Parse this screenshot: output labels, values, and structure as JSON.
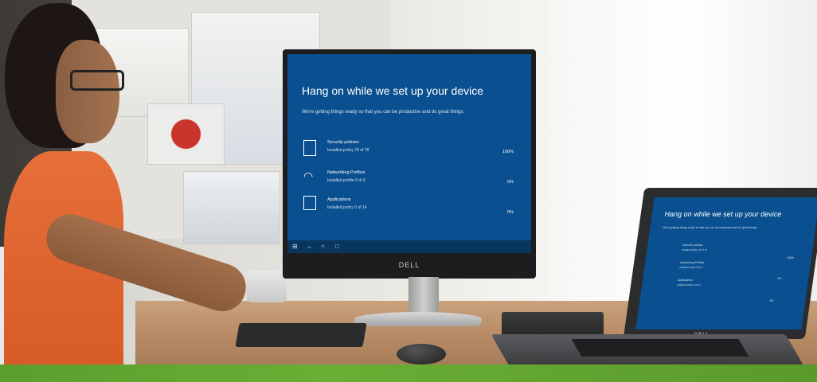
{
  "monitor": {
    "brand": "DELL",
    "screen": {
      "title": "Hang on while we set up your device",
      "subtitle": "We're getting things ready so that you can be productive and do great things.",
      "items": [
        {
          "icon": "document-icon",
          "title": "Security policies",
          "status": "Installed policy 78 of 78",
          "percent": "100%"
        },
        {
          "icon": "wifi-icon",
          "title": "Networking Profiles",
          "status": "Installed profile 0 of 3",
          "percent": "0%"
        },
        {
          "icon": "tablet-icon",
          "title": "Applications",
          "status": "Installed policy 0 of 14",
          "percent": "0%"
        }
      ]
    }
  },
  "laptop": {
    "brand": "DELL",
    "screen": {
      "title": "Hang on while we set up your device",
      "subtitle": "We're getting things ready so that you can be productive and do great things.",
      "items": [
        {
          "title": "Security policies",
          "status": "Installed policy 78 of 78",
          "percent": "100%"
        },
        {
          "title": "Networking Profiles",
          "status": "Installed profile 0 of 3",
          "percent": "0%"
        },
        {
          "title": "Applications",
          "status": "Installed policy 0 of 14",
          "percent": "0%"
        }
      ]
    }
  },
  "colors": {
    "screen_blue": "#0a4f8f",
    "desk_green_strip": "#6aae35",
    "shirt_orange": "#e66f3a"
  }
}
